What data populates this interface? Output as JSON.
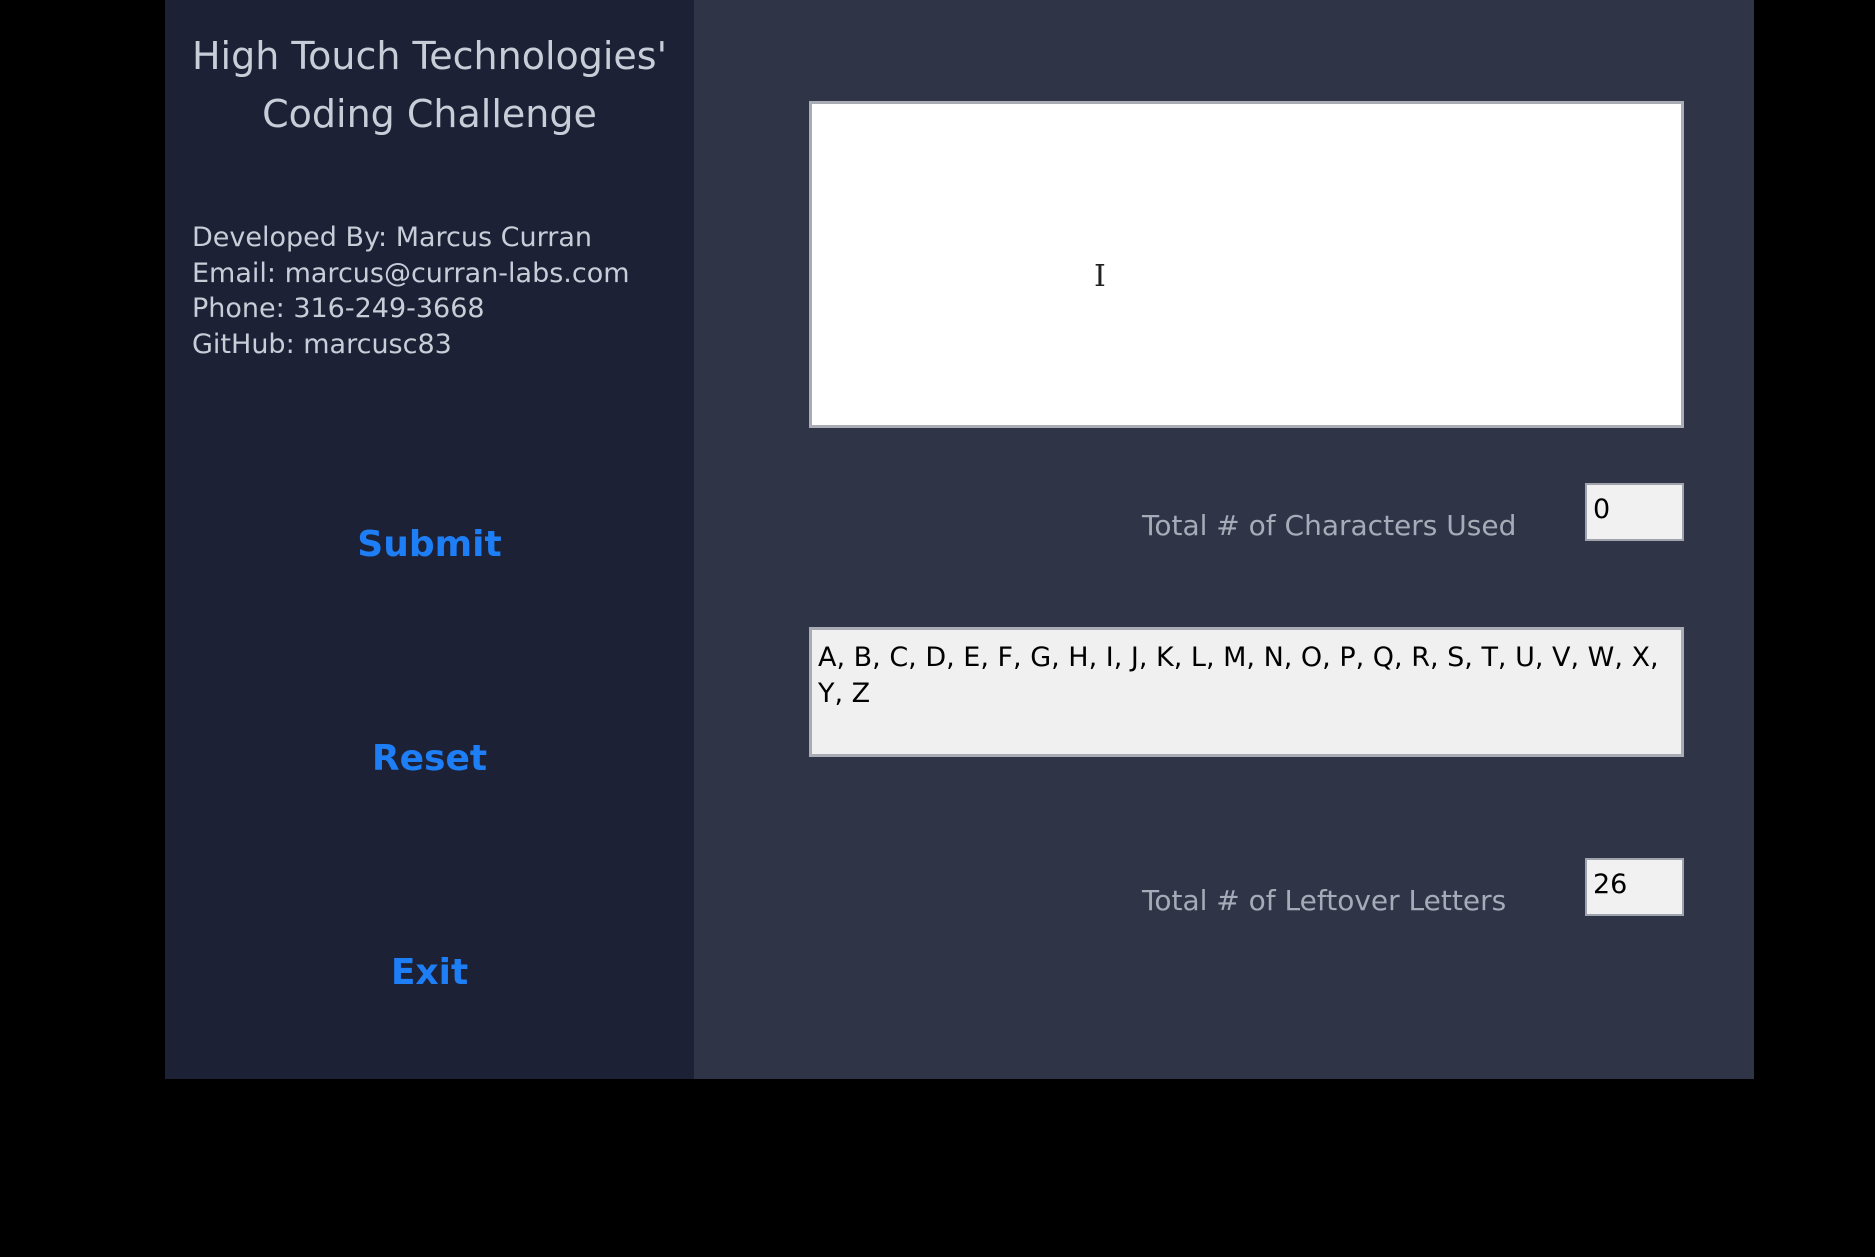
{
  "sidebar": {
    "title_line1": "High Touch Technologies'",
    "title_line2": "Coding Challenge",
    "developer": "Developed By:  Marcus Curran",
    "email": "Email:  marcus@curran-labs.com",
    "phone": "Phone:  316-249-3668",
    "github": "GitHub: marcusc83",
    "buttons": {
      "submit": "Submit",
      "reset": "Reset",
      "exit": "Exit"
    }
  },
  "main": {
    "input_text": "",
    "characters_used_label": "Total # of Characters Used",
    "characters_used_value": "0",
    "leftover_letters_text": "A, B, C, D, E, F, G, H, I, J, K, L, M, N, O, P, Q, R, S, T, U, V, W, X, Y, Z",
    "leftover_count_label": "Total # of Leftover Letters",
    "leftover_count_value": "26"
  },
  "colors": {
    "sidebar_bg": "#1c2136",
    "main_bg": "#2f3447",
    "button_text": "#1e7ef5",
    "sidebar_text": "#c9cdd8"
  },
  "icons": {
    "mouse_cursor": "text-ibeam-cursor-icon"
  }
}
